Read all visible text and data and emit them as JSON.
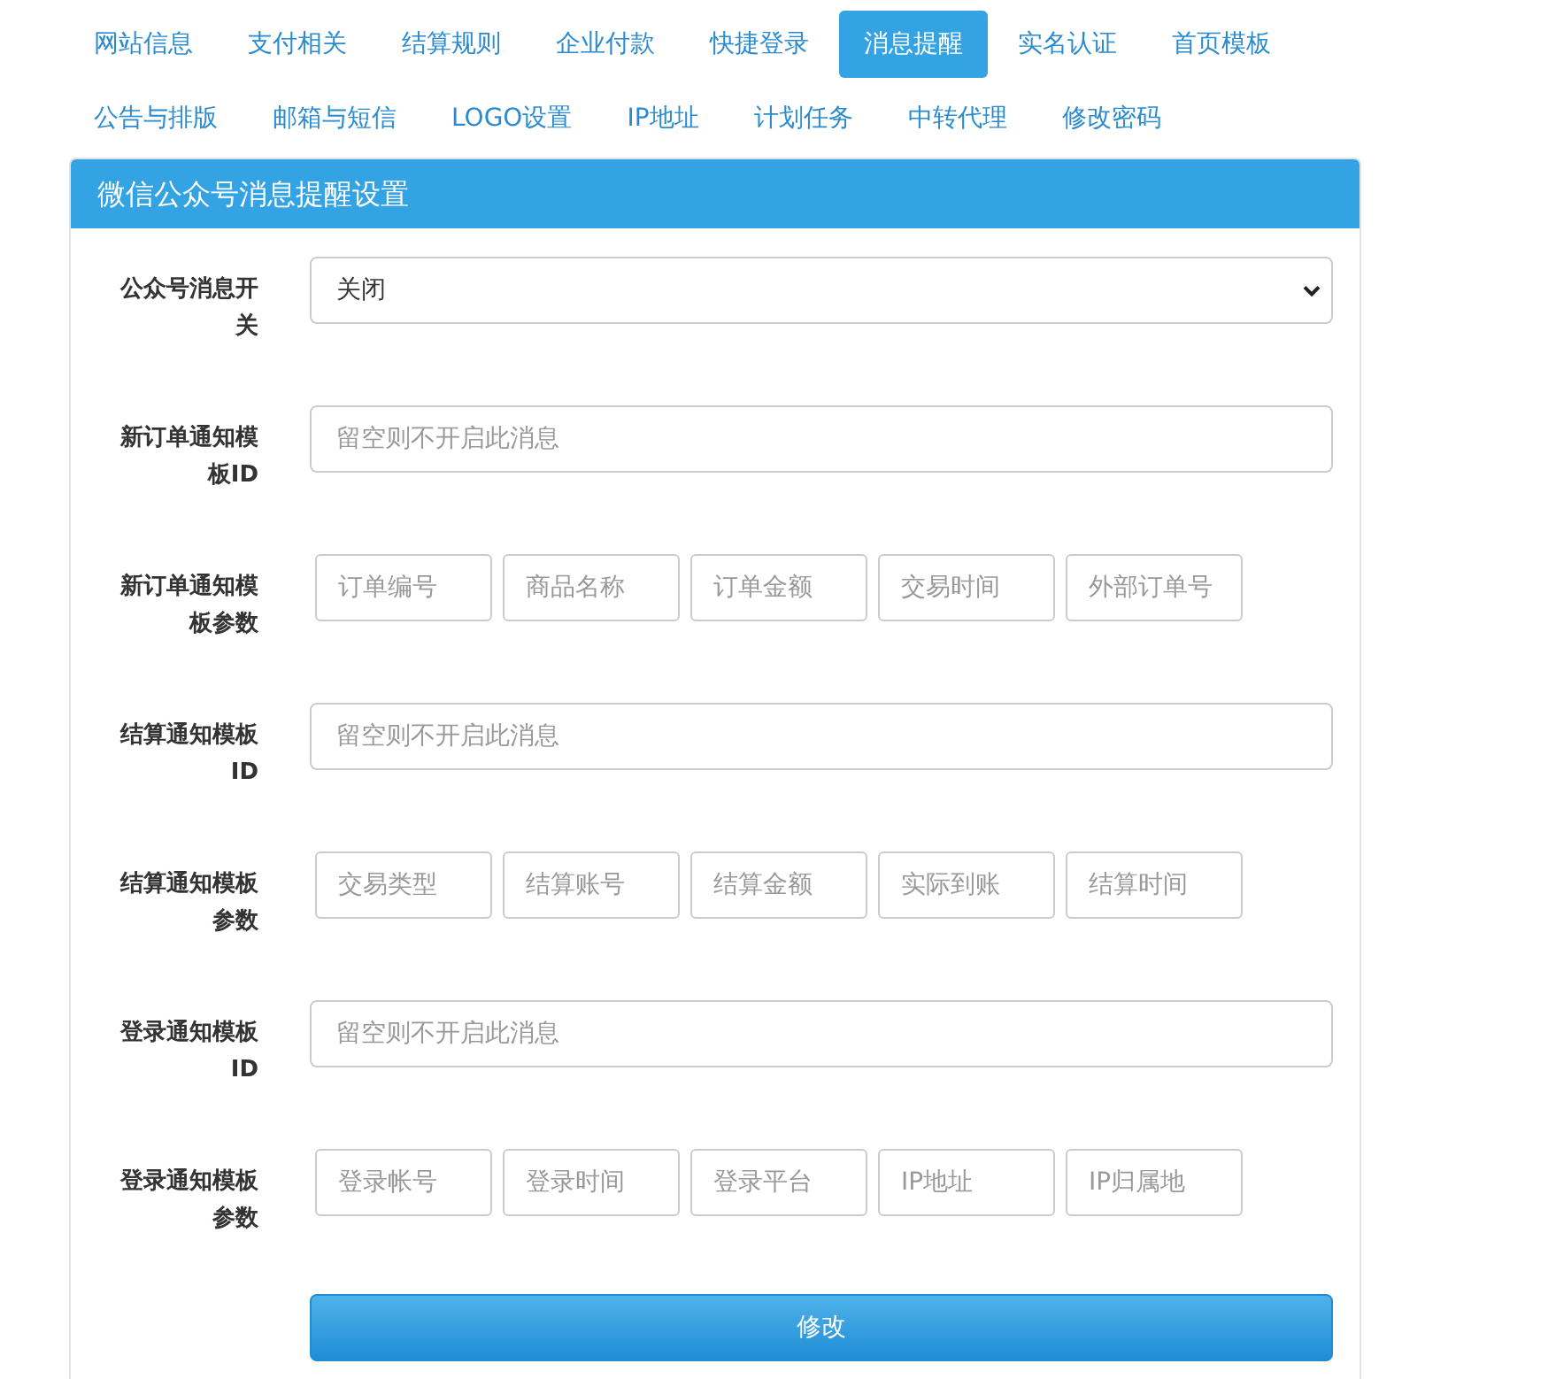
{
  "tabs": [
    {
      "label": "网站信息",
      "selected": false
    },
    {
      "label": "支付相关",
      "selected": false
    },
    {
      "label": "结算规则",
      "selected": false
    },
    {
      "label": "企业付款",
      "selected": false
    },
    {
      "label": "快捷登录",
      "selected": false
    },
    {
      "label": "消息提醒",
      "selected": true
    },
    {
      "label": "实名认证",
      "selected": false
    },
    {
      "label": "首页模板",
      "selected": false
    },
    {
      "label": "公告与排版",
      "selected": false
    },
    {
      "label": "邮箱与短信",
      "selected": false
    },
    {
      "label": "LOGO设置",
      "selected": false
    },
    {
      "label": "IP地址",
      "selected": false
    },
    {
      "label": "计划任务",
      "selected": false
    },
    {
      "label": "中转代理",
      "selected": false
    },
    {
      "label": "修改密码",
      "selected": false
    }
  ],
  "panel": {
    "title": "微信公众号消息提醒设置",
    "rows": [
      {
        "kind": "select",
        "label": "公众号消息开关",
        "value": "关闭"
      },
      {
        "kind": "text",
        "label": "新订单通知模板ID",
        "placeholder": "留空则不开启此消息"
      },
      {
        "kind": "params",
        "label": "新订单通知模板参数",
        "params": [
          "订单编号",
          "商品名称",
          "订单金额",
          "交易时间",
          "外部订单号"
        ]
      },
      {
        "kind": "text",
        "label": "结算通知模板ID",
        "placeholder": "留空则不开启此消息"
      },
      {
        "kind": "params",
        "label": "结算通知模板参数",
        "params": [
          "交易类型",
          "结算账号",
          "结算金额",
          "实际到账",
          "结算时间"
        ]
      },
      {
        "kind": "text",
        "label": "登录通知模板ID",
        "placeholder": "留空则不开启此消息"
      },
      {
        "kind": "params",
        "label": "登录通知模板参数",
        "params": [
          "登录帐号",
          "登录时间",
          "登录平台",
          "IP地址",
          "IP归属地"
        ]
      }
    ],
    "submit": "修改"
  }
}
